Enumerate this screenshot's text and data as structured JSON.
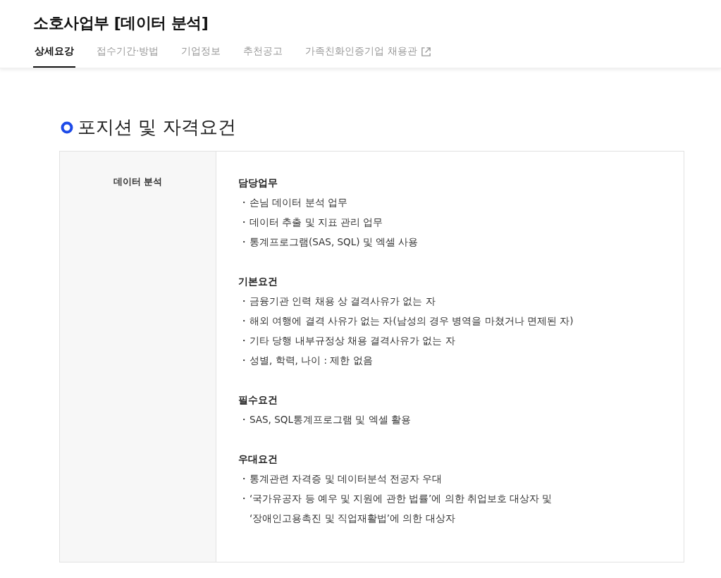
{
  "page_title": "소호사업부 [데이터 분석]",
  "tabs": [
    {
      "label": "상세요강",
      "selected": true,
      "external": false
    },
    {
      "label": "접수기간·방법",
      "selected": false,
      "external": false
    },
    {
      "label": "기업정보",
      "selected": false,
      "external": false
    },
    {
      "label": "추천공고",
      "selected": false,
      "external": false
    },
    {
      "label": "가족친화인증기업 채용관",
      "selected": false,
      "external": true
    }
  ],
  "section": {
    "heading": "포지션 및 자격요건",
    "position": "데이터 분석",
    "groups": [
      {
        "title": "담당업무",
        "items": [
          {
            "bullet": "・",
            "text": "손님 데이터 분석 업무"
          },
          {
            "bullet": "・",
            "text": "데이터 추출 및 지표 관리 업무"
          },
          {
            "bullet": "・",
            "text": "통계프로그램(SAS, SQL) 및 엑셀 사용"
          }
        ]
      },
      {
        "title": "기본요건",
        "items": [
          {
            "bullet": "・",
            "text": "금융기관 인력 채용 상 결격사유가 없는 자"
          },
          {
            "bullet": "・",
            "text": "해외 여행에 결격 사유가 없는 자(남성의 경우 병역을 마쳤거나 면제된 자)"
          },
          {
            "bullet": "・",
            "text": "기타 당행 내부규정상 채용 결격사유가 없는 자"
          },
          {
            "bullet": "・",
            "text": "성별, 학력, 나이 : 제한 없음"
          }
        ]
      },
      {
        "title": "필수요건",
        "items": [
          {
            "bullet": "・",
            "text": "SAS, SQL통계프로그램 및 엑셀 활용"
          }
        ]
      },
      {
        "title": "우대요건",
        "items": [
          {
            "bullet": "・",
            "text": "통계관련 자격증 및 데이터분석 전공자 우대"
          },
          {
            "bullet": "・",
            "text": "‘국가유공자 등 예우 및 지원에 관한 법률’에 의한 취업보호 대상자 및\n‘장애인고용촉진 및 직업재활법’에 의한 대상자"
          }
        ]
      }
    ]
  }
}
